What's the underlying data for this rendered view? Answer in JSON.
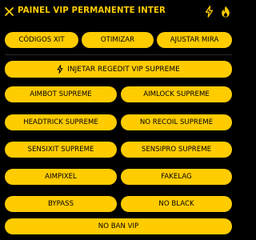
{
  "header": {
    "title": "PAINEL VIP PERMANENTE INTER",
    "icons": [
      "close-icon",
      "lightning-icon",
      "flame-icon"
    ],
    "accent_color": "#ffcc00",
    "background_color": "#000000"
  },
  "top_buttons": {
    "codigos": "CÓDIGOS XIT",
    "otimizar": "OTIMIZAR",
    "mira": "AJUSTAR MIRA"
  },
  "main_button": {
    "label": "INJETAR REGEDIT VIP SUPREME",
    "icon": "lightning-icon"
  },
  "features": {
    "aimbot": "AIMBOT SUPREME",
    "aimlock": "AIMLOCK SUPREME",
    "headtrick": "HEADTRICK SUPREME",
    "norecoil": "NO RECOIL SUPREME",
    "sensixit": "SENSIXIT SUPREME",
    "sensipro": "SENSIPRO SUPREME",
    "aimpixel": "AIMPIXEL",
    "fakelag": "FAKELAG",
    "bypass": "BYPASS",
    "noblack": "NO BLACK",
    "noban": "NO BAN VIP"
  }
}
